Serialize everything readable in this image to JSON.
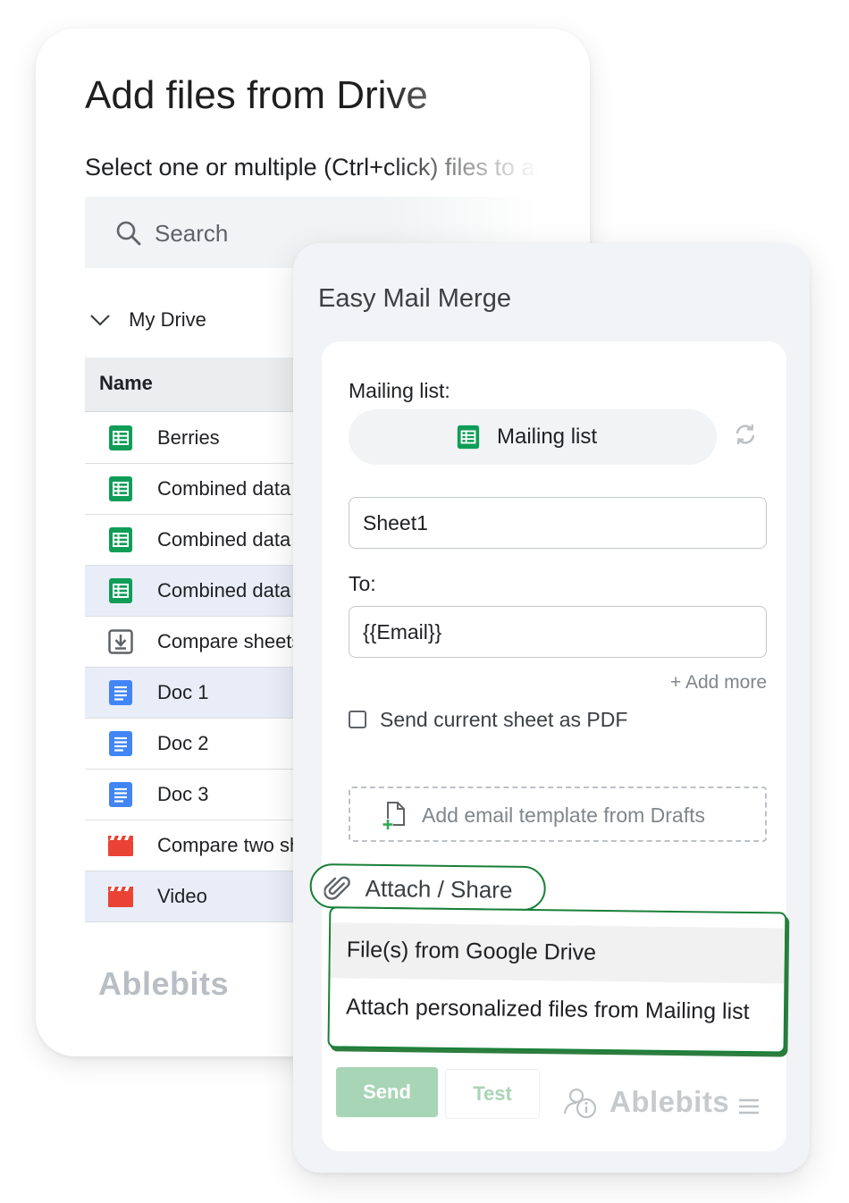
{
  "drive_dialog": {
    "title": "Add files from Drive",
    "subtitle": "Select one or multiple (Ctrl+click) files to add",
    "search": {
      "placeholder": "Search",
      "icon": "search-icon"
    },
    "folder": {
      "label": "My Drive",
      "icon": "chevron-down-icon"
    },
    "table_header": "Name",
    "files": [
      {
        "name": "Berries",
        "icon": "sheets-icon",
        "selected": false
      },
      {
        "name": "Combined data",
        "icon": "sheets-icon",
        "selected": false
      },
      {
        "name": "Combined data",
        "icon": "sheets-icon",
        "selected": false
      },
      {
        "name": "Combined data",
        "icon": "sheets-icon",
        "selected": true
      },
      {
        "name": "Compare sheets",
        "icon": "download-file-icon",
        "selected": false
      },
      {
        "name": "Doc 1",
        "icon": "docs-icon",
        "selected": true
      },
      {
        "name": "Doc 2",
        "icon": "docs-icon",
        "selected": false
      },
      {
        "name": "Doc 3",
        "icon": "docs-icon",
        "selected": false
      },
      {
        "name": "Compare two sheets",
        "icon": "video-icon",
        "selected": false
      },
      {
        "name": "Video",
        "icon": "video-icon",
        "selected": true
      }
    ],
    "brand": "Ablebits"
  },
  "mail_merge": {
    "title": "Easy Mail Merge",
    "mailing_list_label": "Mailing list:",
    "mailing_list_value": "Mailing list",
    "sheet_value": "Sheet1",
    "to_label": "To:",
    "to_value": "{{Email}}",
    "add_more": "+ Add more",
    "pdf_checkbox_label": "Send current sheet as PDF",
    "pdf_checked": false,
    "template_button": "Add email template from Drafts",
    "attach_label": "Attach / Share",
    "attach_menu": [
      "File(s) from Google Drive",
      "Attach personalized files from Mailing list"
    ],
    "send_label": "Send",
    "test_label": "Test",
    "brand": "Ablebits"
  },
  "colors": {
    "accent_green": "#188038",
    "sheets_green": "#0f9d58",
    "docs_blue": "#4285f4",
    "video_red": "#ea4335",
    "send_disabled": "#a8d5b5",
    "selected_row": "#e8edf7"
  }
}
